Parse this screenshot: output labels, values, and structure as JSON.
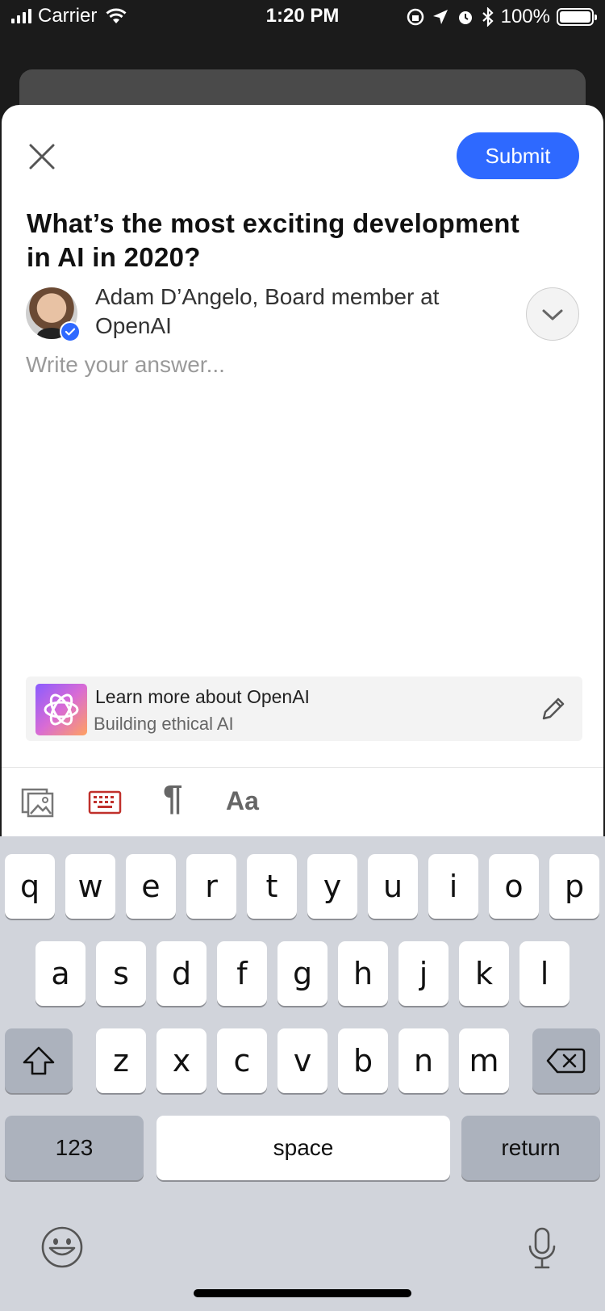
{
  "status_bar": {
    "carrier": "Carrier",
    "time": "1:20 PM",
    "battery": "100%"
  },
  "header": {
    "submit_label": "Submit"
  },
  "question": {
    "title": "What’s the most exciting development in AI in 2020?"
  },
  "author": {
    "credential": "Adam D’Angelo, Board member at OpenAI"
  },
  "editor": {
    "placeholder": "Write your answer..."
  },
  "space": {
    "title": "Learn more about OpenAI",
    "subtitle": "Building ethical AI"
  },
  "toolbar": {
    "paragraph_glyph": "¶",
    "text_style_label": "Aa"
  },
  "keyboard": {
    "row1": [
      "q",
      "w",
      "e",
      "r",
      "t",
      "y",
      "u",
      "i",
      "o",
      "p"
    ],
    "row2": [
      "a",
      "s",
      "d",
      "f",
      "g",
      "h",
      "j",
      "k",
      "l"
    ],
    "row3": [
      "z",
      "x",
      "c",
      "v",
      "b",
      "n",
      "m"
    ],
    "numbers_label": "123",
    "space_label": "space",
    "return_label": "return"
  },
  "colors": {
    "accent": "#2e69ff",
    "keyboard_icon": "#c0302b"
  },
  "icons": [
    "close-icon",
    "chevron-down-icon",
    "verified-icon",
    "openai-logo-icon",
    "pencil-icon",
    "image-icon",
    "keyboard-icon",
    "shift-icon",
    "backspace-icon",
    "emoji-icon",
    "microphone-icon"
  ]
}
